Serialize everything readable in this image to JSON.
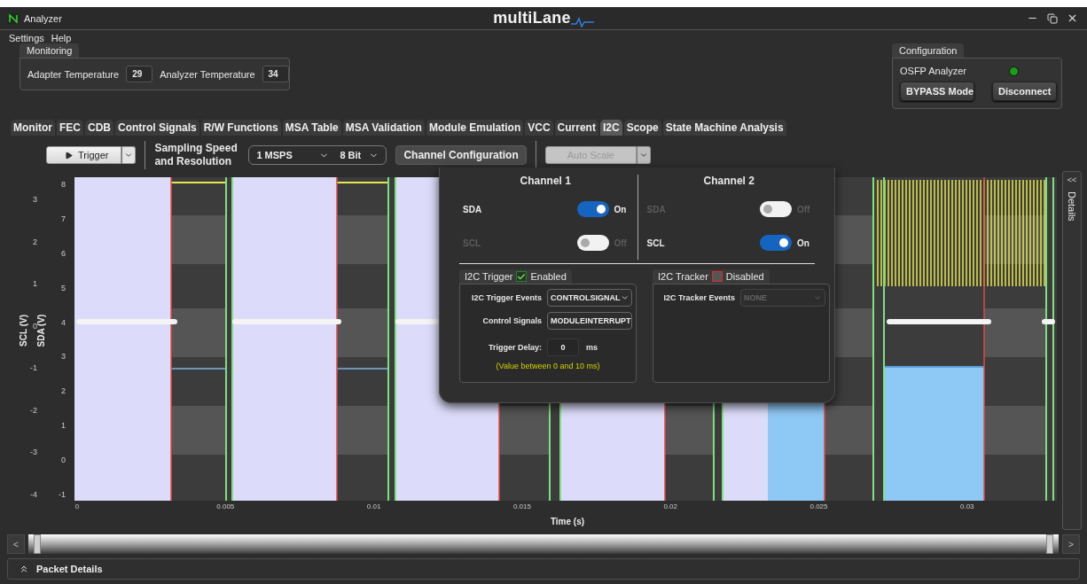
{
  "window": {
    "title": "Analyzer",
    "logo": "multiLane"
  },
  "menu": [
    "Settings",
    "Help"
  ],
  "monitoring": {
    "title": "Monitoring",
    "fields": [
      {
        "label": "Adapter Temperature",
        "value": "29"
      },
      {
        "label": "Analyzer Temperature",
        "value": "34"
      }
    ]
  },
  "configuration": {
    "title": "Configuration",
    "device": "OSFP Analyzer",
    "connected": true,
    "buttons": [
      "BYPASS Mode",
      "Disconnect"
    ]
  },
  "tabs": [
    {
      "label": "Monitor",
      "selected": false
    },
    {
      "label": "FEC",
      "selected": false
    },
    {
      "label": "CDB",
      "selected": false
    },
    {
      "label": "Control Signals",
      "selected": false
    },
    {
      "label": "R/W Functions",
      "selected": false
    },
    {
      "label": "MSA Table",
      "selected": false
    },
    {
      "label": "MSA Validation",
      "selected": false
    },
    {
      "label": "Module Emulation",
      "selected": false
    },
    {
      "label": "VCC",
      "selected": false
    },
    {
      "label": "Current",
      "selected": false
    },
    {
      "label": "I2C",
      "selected": true
    },
    {
      "label": "Scope",
      "selected": false
    },
    {
      "label": "State Machine Analysis",
      "selected": false
    }
  ],
  "toolbar": {
    "trigger": "Trigger",
    "sampling_label": "Sampling Speed and Resolution",
    "speed": "1 MSPS",
    "resolution": "8 Bit",
    "channel_config": "Channel Configuration",
    "auto_scale": {
      "label": "Auto Scale",
      "disabled": true
    }
  },
  "scope": {
    "y_axes": [
      {
        "label": "SCL (V)",
        "ticks": [
          "3",
          "2",
          "1",
          "0",
          "-1",
          "-2",
          "-3",
          "-4"
        ]
      },
      {
        "label": "SDA (V)",
        "ticks": [
          "8",
          "7",
          "6",
          "5",
          "4",
          "3",
          "2",
          "1",
          "0",
          "-1"
        ]
      }
    ],
    "x_ticks": [
      "0",
      "0.005",
      "0.01",
      "0.015",
      "0.02",
      "0.025",
      "0.03"
    ],
    "xlabel": "Time (s)"
  },
  "details_panel": {
    "collapse": "<<",
    "title": "Details"
  },
  "scrollbar": {
    "left": "<",
    "right": ">"
  },
  "packet_details": {
    "title": "Packet Details"
  },
  "channel_dialog": {
    "channels": [
      {
        "title": "Channel 1",
        "signals": [
          {
            "name": "SDA",
            "on": true,
            "state_label": "On"
          },
          {
            "name": "SCL",
            "on": false,
            "state_label": "Off"
          }
        ]
      },
      {
        "title": "Channel 2",
        "signals": [
          {
            "name": "SDA",
            "on": false,
            "state_label": "Off"
          },
          {
            "name": "SCL",
            "on": true,
            "state_label": "On"
          }
        ]
      }
    ],
    "groups": [
      {
        "title": "I2C Trigger",
        "enabled": true,
        "state_label": "Enabled",
        "fields": [
          {
            "kind": "select",
            "label": "I2C Trigger Events",
            "value": "CONTROLSIGNAL",
            "disabled": false
          },
          {
            "kind": "select",
            "label": "Control Signals",
            "value": "MODULEINTERRUPT",
            "disabled": false
          },
          {
            "kind": "number",
            "label": "Trigger Delay:",
            "value": "0",
            "unit": "ms",
            "disabled": false
          }
        ],
        "hint": "(Value between 0 and 10 ms)"
      },
      {
        "title": "I2C Tracker",
        "enabled": false,
        "state_label": "Disabled",
        "fields": [
          {
            "kind": "select",
            "label": "I2C Tracker Events",
            "value": "NONE",
            "disabled": true
          }
        ]
      }
    ]
  }
}
